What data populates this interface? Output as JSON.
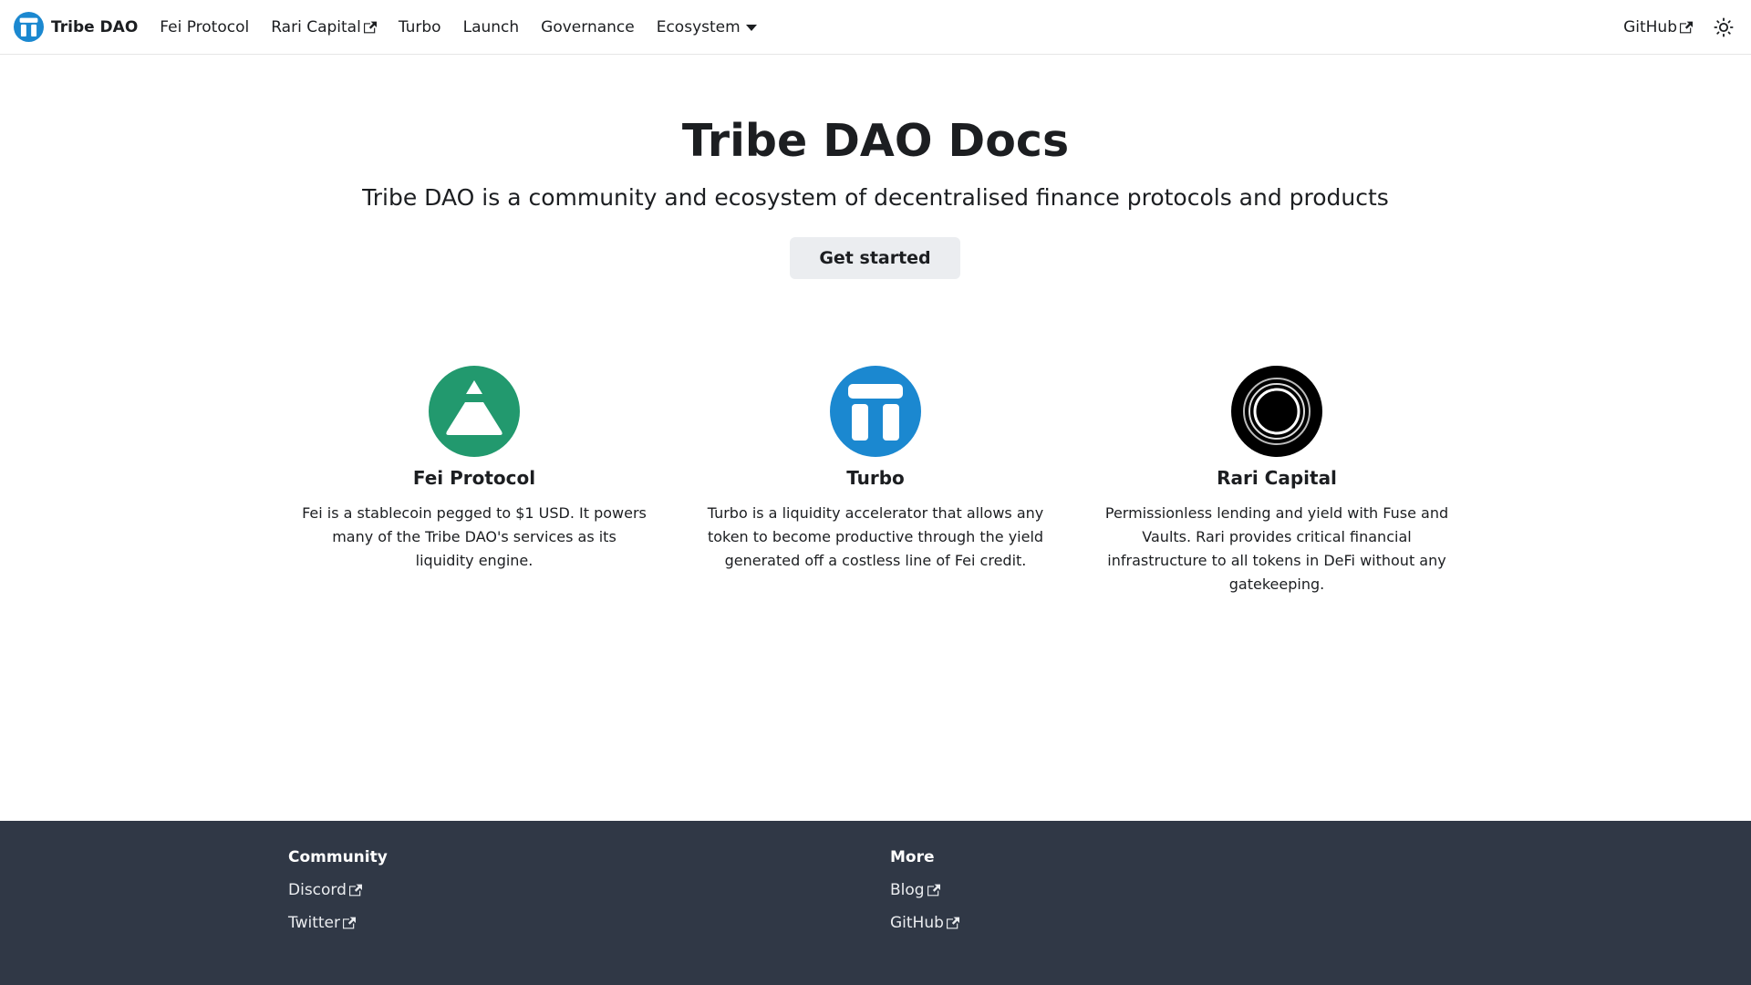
{
  "navbar": {
    "brand": "Tribe DAO",
    "items": [
      {
        "label": "Fei Protocol"
      },
      {
        "label": "Rari Capital"
      },
      {
        "label": "Turbo"
      },
      {
        "label": "Launch"
      },
      {
        "label": "Governance"
      },
      {
        "label": "Ecosystem"
      }
    ],
    "github_label": "GitHub"
  },
  "hero": {
    "title": "Tribe DAO Docs",
    "subtitle": "Tribe DAO is a community and ecosystem of decentralised finance protocols and products",
    "cta_label": "Get started"
  },
  "features": [
    {
      "title": "Fei Protocol",
      "description": "Fei is a stablecoin pegged to $1 USD. It powers many of the Tribe DAO's services as its liquidity engine.",
      "color": "#22996e"
    },
    {
      "title": "Turbo",
      "description": "Turbo is a liquidity accelerator that allows any token to become productive through the yield generated off a costless line of Fei credit.",
      "color": "#1b88d0"
    },
    {
      "title": "Rari Capital",
      "description": "Permissionless lending and yield with Fuse and Vaults. Rari provides critical financial infrastructure to all tokens in DeFi without any gatekeeping.",
      "color": "#000000"
    }
  ],
  "footer": {
    "columns": [
      {
        "title": "Community",
        "links": [
          {
            "label": "Discord"
          },
          {
            "label": "Twitter"
          }
        ]
      },
      {
        "title": "More",
        "links": [
          {
            "label": "Blog"
          },
          {
            "label": "GitHub"
          }
        ]
      }
    ],
    "background": "#303846"
  }
}
